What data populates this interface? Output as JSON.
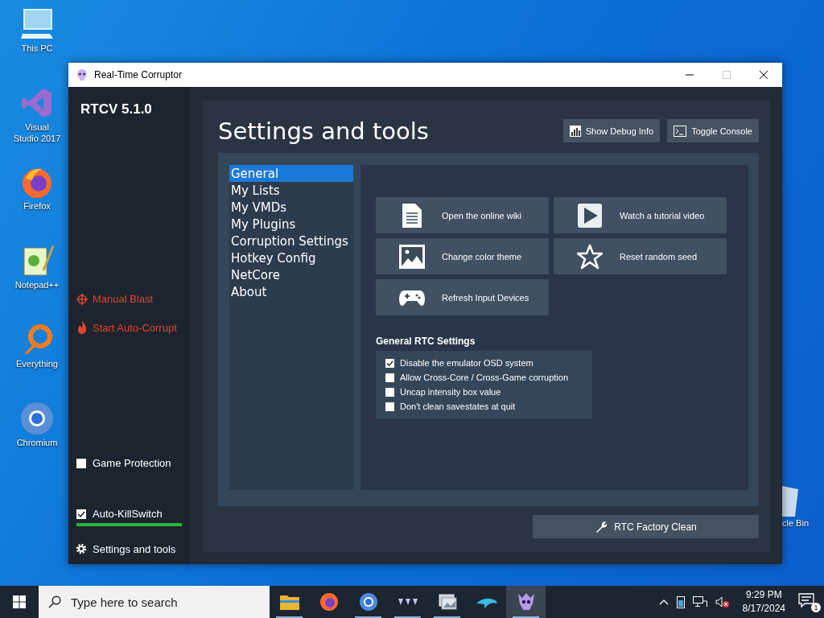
{
  "desktop_icons": [
    {
      "kind": "pc",
      "label": "This PC"
    },
    {
      "kind": "vs",
      "label": "Visual Studio 2017"
    },
    {
      "kind": "firefox",
      "label": "Firefox"
    },
    {
      "kind": "notepad",
      "label": "Notepad++"
    },
    {
      "kind": "everything",
      "label": "Everything"
    },
    {
      "kind": "chromium",
      "label": "Chromium"
    },
    {
      "kind": "bin",
      "label": "cle Bin"
    }
  ],
  "window": {
    "title": "Real-Time Corruptor",
    "maximize_disabled": true
  },
  "sidebar": {
    "version": "RTCV 5.1.0",
    "actions": [
      {
        "kind": "blast",
        "label": "Manual Blast"
      },
      {
        "kind": "fire",
        "label": "Start Auto-Corrupt"
      }
    ],
    "game_protection": {
      "label": "Game Protection",
      "checked": false
    },
    "killswitch": {
      "label": "Auto-KillSwitch",
      "checked": true,
      "level": 1
    },
    "settings_link": "Settings and tools"
  },
  "main": {
    "title": "Settings and tools",
    "header_buttons": [
      {
        "kind": "chart",
        "label": "Show Debug Info"
      },
      {
        "kind": "console",
        "label": "Toggle Console"
      }
    ],
    "menu": [
      {
        "label": "General",
        "selected": true
      },
      {
        "label": "My Lists",
        "selected": false
      },
      {
        "label": "My VMDs",
        "selected": false
      },
      {
        "label": "My Plugins",
        "selected": false
      },
      {
        "label": "Corruption Settings",
        "selected": false
      },
      {
        "label": "Hotkey Config",
        "selected": false
      },
      {
        "label": "NetCore",
        "selected": false
      },
      {
        "label": "About",
        "selected": false
      }
    ],
    "tiles": [
      {
        "kind": "document",
        "label": "Open the online wiki"
      },
      {
        "kind": "play",
        "label": "Watch a tutorial video"
      },
      {
        "kind": "image",
        "label": "Change color theme"
      },
      {
        "kind": "star",
        "label": "Reset random seed"
      },
      {
        "kind": "gamepad",
        "label": "Refresh Input Devices"
      }
    ],
    "settings_group": {
      "title": "General RTC Settings",
      "options": [
        {
          "label": "Disable the emulator OSD system",
          "checked": true
        },
        {
          "label": "Allow Cross-Core / Cross-Game corruption",
          "checked": false
        },
        {
          "label": "Uncap intensity box value",
          "checked": false
        },
        {
          "label": "Don't clean savestates at quit",
          "checked": false
        }
      ]
    },
    "factory_button": "RTC Factory Clean"
  },
  "taskbar": {
    "search_placeholder": "Type here to search",
    "apps": [
      {
        "kind": "explorer",
        "running": true,
        "active": false
      },
      {
        "kind": "firefox",
        "running": false,
        "active": false
      },
      {
        "kind": "chromium",
        "running": true,
        "active": false
      },
      {
        "kind": "wave",
        "running": true,
        "active": false
      },
      {
        "kind": "photos",
        "running": true,
        "active": false
      },
      {
        "kind": "dolphin",
        "running": false,
        "active": false
      },
      {
        "kind": "rtc",
        "running": true,
        "active": true
      }
    ],
    "time": "9:29 PM",
    "date": "8/17/2024",
    "notification_count": "1"
  }
}
